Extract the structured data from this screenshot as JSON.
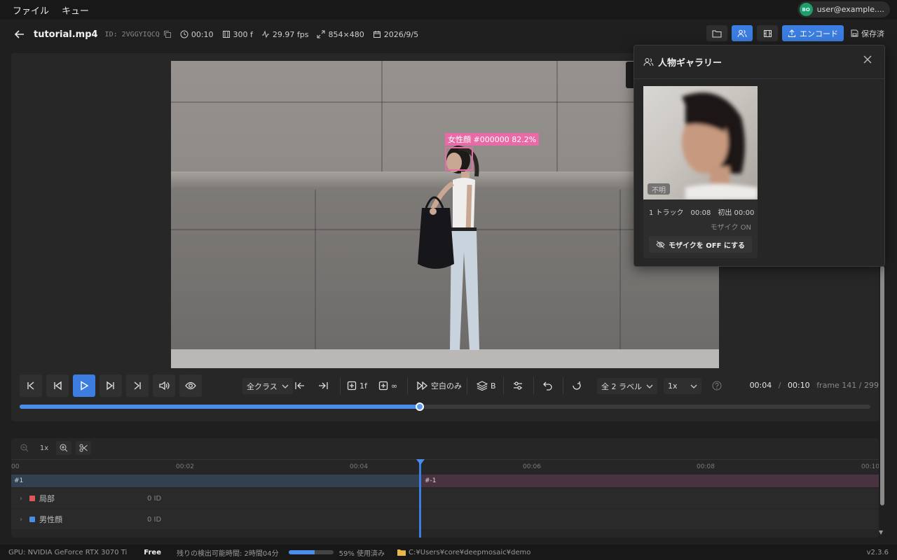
{
  "menubar": {
    "items": [
      "ファイル",
      "キュー"
    ],
    "user": {
      "initials": "BO",
      "email": "user@example...."
    }
  },
  "header": {
    "filename": "tutorial.mp4",
    "id": "ID: 2VGGYIQCQ",
    "duration": "00:10",
    "frames": "300 f",
    "fps": "29.97 fps",
    "resolution": "854×480",
    "date": "2026/9/5",
    "encode_label": "エンコード",
    "saved_label": "保存済"
  },
  "video": {
    "detection_label": "女性顔 #000000 82.2%"
  },
  "controls": {
    "class_select": "全クラス",
    "step_1f": "1f",
    "step_inf": "∞",
    "blank_only": "空白のみ",
    "layer_label": "B",
    "labels_select": "全 2 ラベル",
    "speed_select": "1x",
    "current_time": "00:04",
    "separator": "/",
    "total_time": "00:10",
    "frame_info": "frame 141 / 299",
    "progress_fraction": 0.47
  },
  "timeline": {
    "zoom_label": "1x",
    "ticks": [
      "00",
      "00:02",
      "00:04",
      "00:06",
      "00:08",
      "00:10"
    ],
    "track_a": "#1",
    "track_b": "#-1",
    "rows": [
      {
        "name": "局部",
        "count": "0 ID",
        "color": "#e05555"
      },
      {
        "name": "男性顔",
        "count": "0 ID",
        "color": "#4a8ee8"
      }
    ]
  },
  "status": {
    "gpu": "GPU: NVIDIA GeForce RTX 3070 Ti",
    "plan": "Free",
    "remaining": "残りの検出可能時間: 2時間04分",
    "usage": "59% 使用済み",
    "usage_fraction": 0.59,
    "path": "C:¥Users¥core¥deepmosaic¥demo",
    "version": "v2.3.6"
  },
  "gallery": {
    "title": "人物ギャラリー",
    "card": {
      "tag": "不明",
      "stats": "1 トラック　00:08　初出 00:00",
      "mosaic_state": "モザイク ON",
      "off_button": "モザイクを OFF にする"
    }
  },
  "colors": {
    "accent": "#3b7de0",
    "detection": "#e86aa6",
    "bg": "#1f1f1f"
  }
}
